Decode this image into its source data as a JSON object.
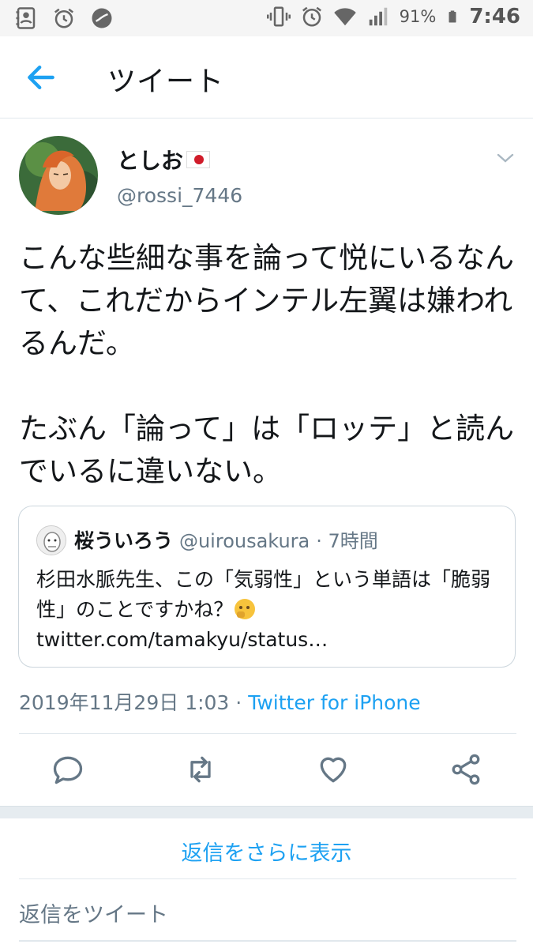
{
  "status_bar": {
    "battery_percent": "91%",
    "time": "7:46",
    "left_icons": [
      "contacts-icon",
      "alarm-icon",
      "app-icon"
    ],
    "right_icons": [
      "vibrate-icon",
      "alarm-icon",
      "wifi-icon",
      "signal-icon",
      "battery-icon"
    ]
  },
  "header": {
    "title": "ツイート",
    "back_icon": "arrow-left-icon"
  },
  "tweet": {
    "user_name": "としお",
    "user_handle": "@rossi_7446",
    "text_paragraph_1": "こんな些細な事を論って悦にいるなんて、これだからインテル左翼は嫌われるんだ。",
    "text_paragraph_2": "たぶん「論って」は「ロッテ」と読んでいるに違いない。",
    "timestamp": "2019年11月29日 1:03",
    "separator": " · ",
    "source": "Twitter for iPhone"
  },
  "quoted_tweet": {
    "user_name": "桜ういろう",
    "user_handle": "@uirousakura",
    "time_ago": "· 7時間",
    "text_before_emoji": "杉田水脈先生、この「気弱性」という単語は「脆弱性」のことですかね？",
    "text_after_emoji": " twitter.com/tamakyu/status…"
  },
  "actions": [
    "reply-icon",
    "retweet-icon",
    "like-icon",
    "share-icon"
  ],
  "more_replies_label": "返信をさらに表示",
  "reply_placeholder": "返信をツイート",
  "colors": {
    "accent": "#1da1f2",
    "secondary_text": "#657786",
    "primary_text": "#14171a",
    "divider": "#e1e8ed"
  }
}
